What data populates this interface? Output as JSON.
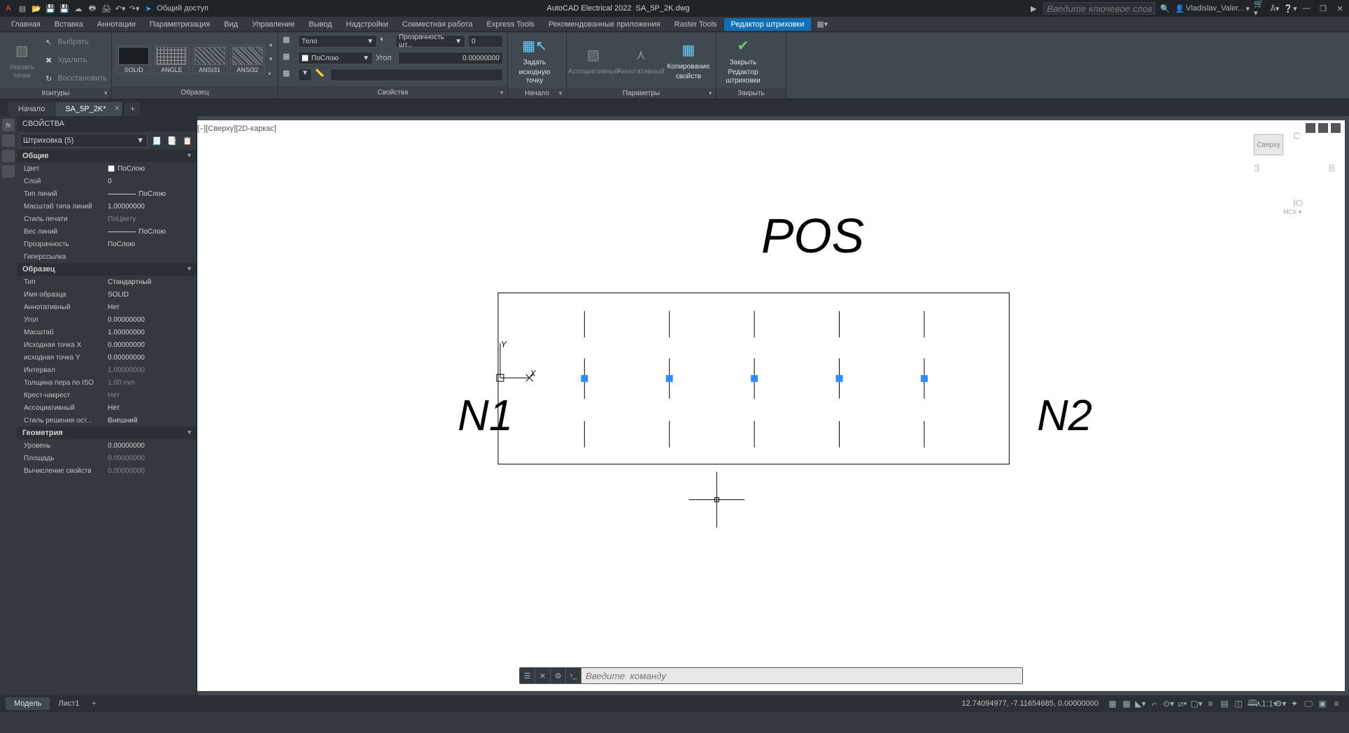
{
  "title": {
    "app": "AutoCAD Electrical 2022",
    "file": "SA_5P_2K.dwg"
  },
  "qat_share": "Общий доступ",
  "search_placeholder": "Введите ключевое слово/фразу",
  "user": "Vladislav_Valer...",
  "ribbon_tabs": [
    "Главная",
    "Вставка",
    "Аннотации",
    "Параметризация",
    "Вид",
    "Управление",
    "Вывод",
    "Надстройки",
    "Совместная работа",
    "Express Tools",
    "Рекомендованные приложения",
    "Raster Tools",
    "Редактор штриховки"
  ],
  "active_ribbon_tab": 12,
  "panels": {
    "contours": {
      "title": "Контуры",
      "pick": "Указать точки",
      "select": "Выбрать",
      "delete": "Удалить",
      "recreate": "Восстановить"
    },
    "pattern": {
      "title": "Образец",
      "items": [
        "SOLID",
        "ANGLE",
        "ANSI31",
        "ANSI32"
      ]
    },
    "props": {
      "title": "Свойства",
      "hatch_type": "Тело",
      "color": "ПоСлою",
      "transp_label": "Прозрачность шт...",
      "transp_val": "0",
      "angle_label": "Угол",
      "angle_val": "0.00000000"
    },
    "origin": {
      "title": "Начало",
      "set": "Задать",
      "set2": "исходную точку"
    },
    "params": {
      "title": "Параметры",
      "assoc": "Ассоциативный",
      "annot": "Аннотативный",
      "copy": "Копирование",
      "copy2": "свойств"
    },
    "close": {
      "title": "Закрыть",
      "close1": "Закрыть",
      "close2": "Редактор штриховки"
    }
  },
  "doc_tabs": {
    "start": "Начало",
    "file": "SA_5P_2K*"
  },
  "properties": {
    "title": "СВОЙСТВА",
    "selection": "Штриховка (5)",
    "groups": {
      "general": {
        "title": "Общие",
        "rows": [
          [
            "Цвет",
            "ПоСлою"
          ],
          [
            "Слой",
            "0"
          ],
          [
            "Тип линий",
            "ПоСлою"
          ],
          [
            "Масштаб типа линий",
            "1.00000000"
          ],
          [
            "Стиль печати",
            "ПоЦвету"
          ],
          [
            "Вес линий",
            "ПоСлою"
          ],
          [
            "Прозрачность",
            "ПоСлою"
          ],
          [
            "Гиперссылка",
            ""
          ]
        ]
      },
      "pattern": {
        "title": "Образец",
        "rows": [
          [
            "Тип",
            "Стандартный"
          ],
          [
            "Имя образца",
            "SOLID"
          ],
          [
            "Аннотативный",
            "Нет"
          ],
          [
            "Угол",
            "0.00000000"
          ],
          [
            "Масштаб",
            "1.00000000"
          ],
          [
            "Исходная точка X",
            "0.00000000"
          ],
          [
            "исходная точка Y",
            "0.00000000"
          ],
          [
            "Интервал",
            "1.00000000"
          ],
          [
            "Толщина пера по ISO",
            "1.00 mm"
          ],
          [
            "Крест-накрест",
            "Нет"
          ],
          [
            "Ассоциативный",
            "Нет"
          ],
          [
            "Стиль  решения  ост...",
            "Внешний"
          ]
        ]
      },
      "geom": {
        "title": "Геометрия",
        "rows": [
          [
            "Уровень",
            "0.00000000"
          ],
          [
            "Площадь",
            "0.00000000"
          ],
          [
            "Вычисление свойств",
            "0.00000000"
          ]
        ]
      }
    }
  },
  "viewport_label": "[–][Сверху][2D-каркас]",
  "viewcube": {
    "n": "С",
    "s": "Ю",
    "e": "В",
    "w": "З",
    "top": "Сверху",
    "wcs": "МСК"
  },
  "drawing": {
    "pos": "POS",
    "n1": "N1",
    "n2": "N2",
    "y": "Y",
    "x": "X"
  },
  "cmdline_placeholder": "Введите  команду",
  "status": {
    "model": "Модель",
    "sheet": "Лист1",
    "coords": "12.74094977, -7.11654685, 0.00000000",
    "scale": "1:1"
  }
}
